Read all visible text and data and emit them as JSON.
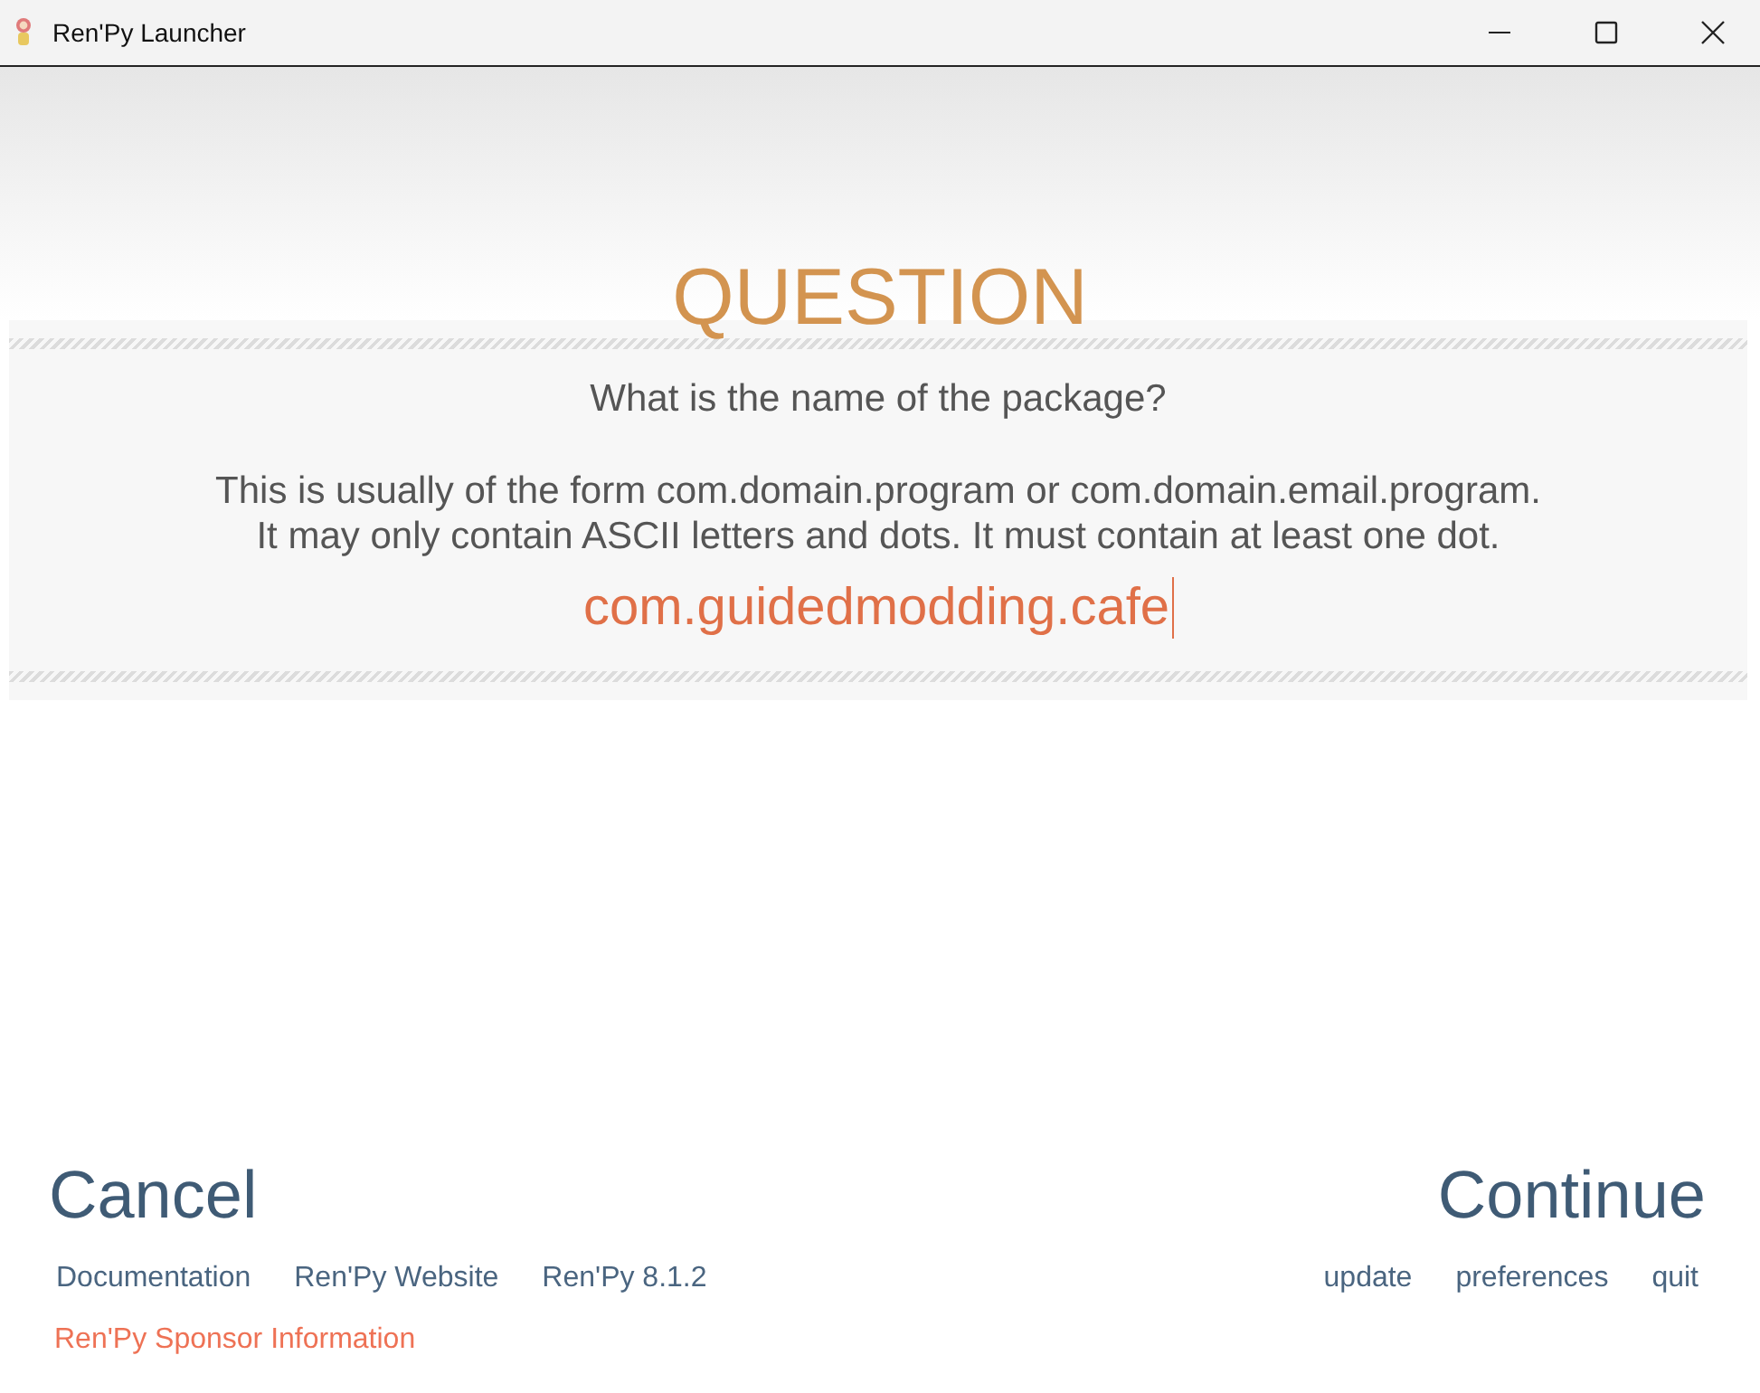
{
  "window": {
    "title": "Ren'Py Launcher"
  },
  "question": {
    "heading": "QUESTION",
    "prompt": "What is the name of the package?",
    "help_lines": [
      "This is usually of the form com.domain.program or com.domain.email.program.",
      "It may only contain ASCII letters and dots. It must contain at least one dot."
    ],
    "input": {
      "value": "com.guidedmodding.cafe"
    }
  },
  "actions": {
    "cancel": "Cancel",
    "continue": "Continue"
  },
  "footer": {
    "left_links": [
      "Documentation",
      "Ren'Py Website",
      "Ren'Py 8.1.2"
    ],
    "right_links": [
      "update",
      "preferences",
      "quit"
    ],
    "sponsor_link": "Ren'Py Sponsor Information"
  }
}
